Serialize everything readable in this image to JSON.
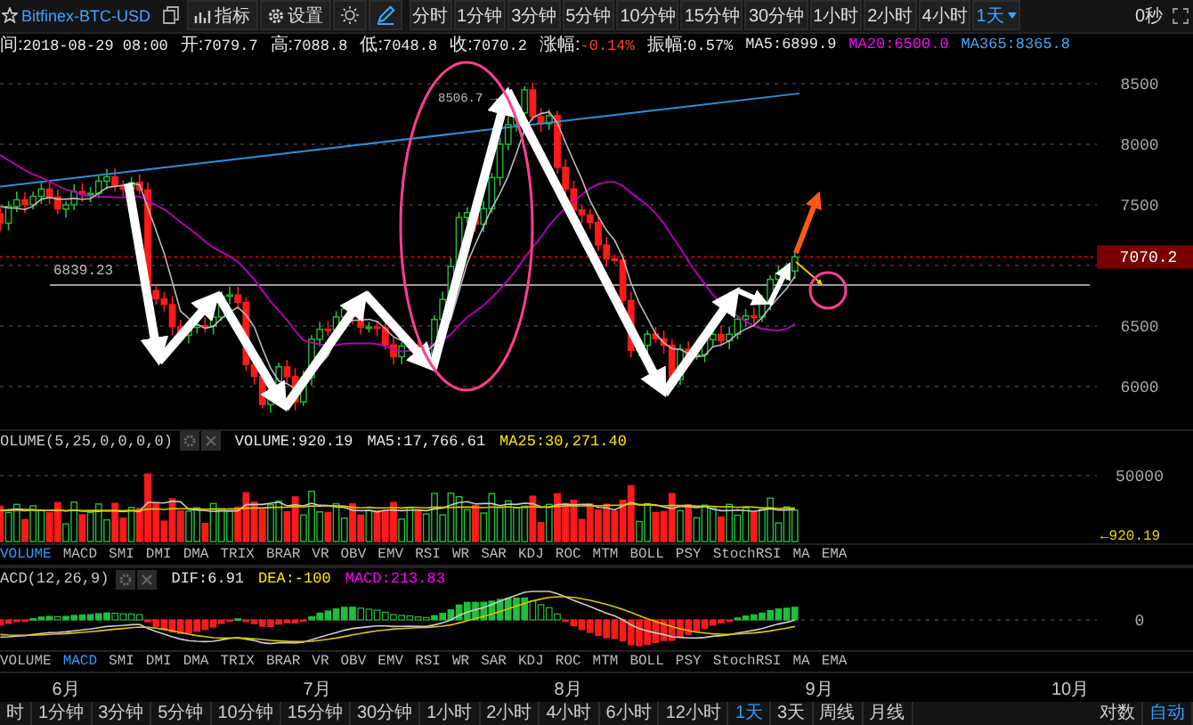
{
  "toolbar": {
    "symbol": "Bitfinex-BTC-USD",
    "buttons": [
      {
        "label": "指标",
        "kind": "chart"
      },
      {
        "label": "设置",
        "kind": "gear"
      }
    ],
    "periods": [
      {
        "label": "分时",
        "selected": false,
        "kind": "tab"
      },
      {
        "label": "1分钟",
        "selected": false,
        "kind": "tab"
      },
      {
        "label": "3分钟",
        "selected": false,
        "kind": "tab"
      },
      {
        "label": "5分钟",
        "selected": false,
        "kind": "tab"
      },
      {
        "label": "10分钟",
        "selected": false,
        "kind": "tab"
      },
      {
        "label": "15分钟",
        "selected": false,
        "kind": "tab"
      },
      {
        "label": "30分钟",
        "selected": false,
        "kind": "tab"
      },
      {
        "label": "1小时",
        "selected": false,
        "kind": "tab"
      },
      {
        "label": "2小时",
        "selected": false,
        "kind": "tab"
      },
      {
        "label": "4小时",
        "selected": false,
        "kind": "tab"
      },
      {
        "label": "1天",
        "selected": true,
        "kind": "dropdown"
      }
    ],
    "countdown": "0秒"
  },
  "info": [
    {
      "label": "间:",
      "value": "2018-08-29 08:00",
      "kind": "plain"
    },
    {
      "label": "开:",
      "value": "7079.7",
      "kind": "plain"
    },
    {
      "label": "高:",
      "value": "7088.8",
      "kind": "plain"
    },
    {
      "label": "低:",
      "value": "7048.8",
      "kind": "plain"
    },
    {
      "label": "收:",
      "value": "7070.2",
      "kind": "plain"
    },
    {
      "label": "涨幅:",
      "value": "-0.14%",
      "kind": "change",
      "color": "#ff4040"
    },
    {
      "label": "振幅:",
      "value": "0.57%",
      "kind": "plain"
    },
    {
      "label": "MA5:",
      "value": "6899.9",
      "kind": "average",
      "color": "#e8e8e8"
    },
    {
      "label": "MA20:",
      "value": "6500.0",
      "kind": "average",
      "color": "#ff00ff"
    },
    {
      "label": "MA365:",
      "value": "8365.8",
      "kind": "average",
      "color": "#3ea6ff"
    }
  ],
  "main_chart": {
    "y_labels": [
      "8500",
      "8000",
      "7500",
      "6500",
      "6000"
    ],
    "price_tag": "7070.2",
    "high_label": "8506.7 →",
    "low_label": "6839.23"
  },
  "volume": {
    "title": "OLUME(5,25,0,0,0,0)",
    "readings": [
      {
        "text": "VOLUME:920.19",
        "color": "#e8e8e8"
      },
      {
        "text": "MA5:17,766.61",
        "color": "#e8e8e8"
      },
      {
        "text": "MA25:30,271.40",
        "color": "#ffe600"
      }
    ],
    "y_label": "50000",
    "tag": "←920.19"
  },
  "indicator_tabs": [
    {
      "label": "VOLUME",
      "selected": true
    },
    {
      "label": "MACD",
      "selected": false
    },
    {
      "label": "SMI",
      "selected": false
    },
    {
      "label": "DMI",
      "selected": false
    },
    {
      "label": "DMA",
      "selected": false
    },
    {
      "label": "TRIX",
      "selected": false
    },
    {
      "label": "BRAR",
      "selected": false
    },
    {
      "label": "VR",
      "selected": false
    },
    {
      "label": "OBV",
      "selected": false
    },
    {
      "label": "EMV",
      "selected": false
    },
    {
      "label": "RSI",
      "selected": false
    },
    {
      "label": "WR",
      "selected": false
    },
    {
      "label": "SAR",
      "selected": false
    },
    {
      "label": "KDJ",
      "selected": false
    },
    {
      "label": "ROC",
      "selected": false
    },
    {
      "label": "MTM",
      "selected": false
    },
    {
      "label": "BOLL",
      "selected": false
    },
    {
      "label": "PSY",
      "selected": false
    },
    {
      "label": "StochRSI",
      "selected": false
    },
    {
      "label": "MA",
      "selected": false
    },
    {
      "label": "EMA",
      "selected": false
    }
  ],
  "macd": {
    "title": "ACD(12,26,9)",
    "readings": [
      {
        "text": "DIF:6.91",
        "color": "#e8e8e8"
      },
      {
        "text": "DEA:-100",
        "color": "#ffe600"
      },
      {
        "text": "MACD:213.83",
        "color": "#ff00ff"
      }
    ],
    "y_label": "0"
  },
  "indicator_tabs_2": [
    {
      "label": "VOLUME",
      "selected": false
    },
    {
      "label": "MACD",
      "selected": true
    },
    {
      "label": "SMI",
      "selected": false
    },
    {
      "label": "DMI",
      "selected": false
    },
    {
      "label": "DMA",
      "selected": false
    },
    {
      "label": "TRIX",
      "selected": false
    },
    {
      "label": "BRAR",
      "selected": false
    },
    {
      "label": "VR",
      "selected": false
    },
    {
      "label": "OBV",
      "selected": false
    },
    {
      "label": "EMV",
      "selected": false
    },
    {
      "label": "RSI",
      "selected": false
    },
    {
      "label": "WR",
      "selected": false
    },
    {
      "label": "SAR",
      "selected": false
    },
    {
      "label": "KDJ",
      "selected": false
    },
    {
      "label": "ROC",
      "selected": false
    },
    {
      "label": "MTM",
      "selected": false
    },
    {
      "label": "BOLL",
      "selected": false
    },
    {
      "label": "PSY",
      "selected": false
    },
    {
      "label": "StochRSI",
      "selected": false
    },
    {
      "label": "MA",
      "selected": false
    },
    {
      "label": "EMA",
      "selected": false
    }
  ],
  "months": [
    "6月",
    "7月",
    "8月",
    "9月",
    "10月"
  ],
  "bottom_periods": [
    {
      "label": "时",
      "selected": false
    },
    {
      "label": "1分钟",
      "selected": false
    },
    {
      "label": "3分钟",
      "selected": false
    },
    {
      "label": "5分钟",
      "selected": false
    },
    {
      "label": "10分钟",
      "selected": false
    },
    {
      "label": "15分钟",
      "selected": false
    },
    {
      "label": "30分钟",
      "selected": false
    },
    {
      "label": "1小时",
      "selected": false
    },
    {
      "label": "2小时",
      "selected": false
    },
    {
      "label": "4小时",
      "selected": false
    },
    {
      "label": "6小时",
      "selected": false
    },
    {
      "label": "12小时",
      "selected": false
    },
    {
      "label": "1天",
      "selected": true
    },
    {
      "label": "3天",
      "selected": false
    },
    {
      "label": "周线",
      "selected": false
    },
    {
      "label": "月线",
      "selected": false
    }
  ],
  "scale_buttons": [
    {
      "label": "对数",
      "selected": false
    },
    {
      "label": "自动",
      "selected": true
    }
  ]
}
